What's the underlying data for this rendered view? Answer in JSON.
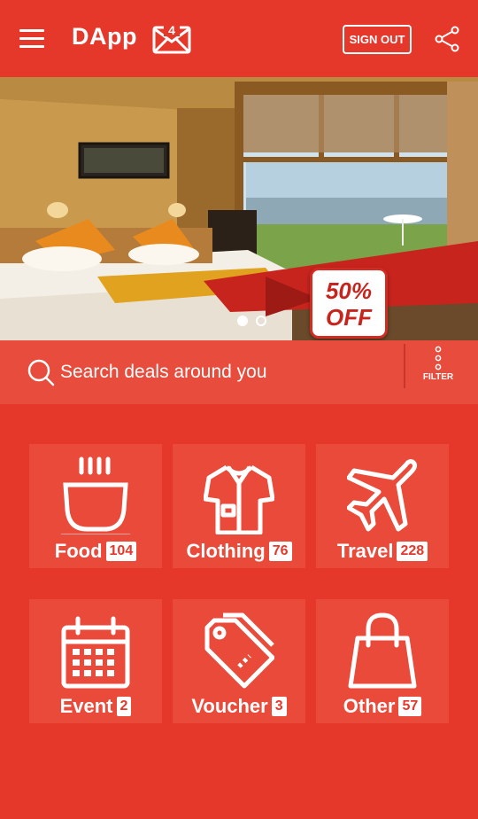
{
  "header": {
    "title": "DApp",
    "mail_badge": "4",
    "signout_label": "SIGN OUT",
    "icons": [
      "menu-icon",
      "mail-icon",
      "share-icon"
    ]
  },
  "banner": {
    "offer_line1": "50%",
    "offer_line2": "OFF",
    "slides_total": 2,
    "active_slide": 1
  },
  "search": {
    "placeholder": "Search deals around you",
    "filter_label": "FILTER"
  },
  "categories": [
    {
      "label": "Food",
      "count": "104",
      "icon": "food-bowl-icon"
    },
    {
      "label": "Clothing",
      "count": "76",
      "icon": "shirt-icon"
    },
    {
      "label": "Travel",
      "count": "228",
      "icon": "airplane-icon"
    },
    {
      "label": "Event",
      "count": "2",
      "icon": "calendar-icon"
    },
    {
      "label": "Voucher",
      "count": "3",
      "icon": "voucher-tag-icon"
    },
    {
      "label": "Other",
      "count": "57",
      "icon": "shopping-bag-icon"
    }
  ],
  "colors": {
    "primary": "#e5372a",
    "tile": "#e94a3a",
    "search_bar": "#e74c3c"
  }
}
